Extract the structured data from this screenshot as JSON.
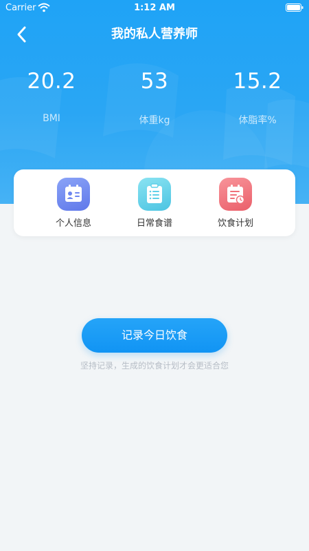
{
  "status_bar": {
    "carrier": "Carrier",
    "time": "1:12 AM"
  },
  "nav": {
    "title": "我的私人营养师"
  },
  "stats": [
    {
      "value": "20.2",
      "label": "BMI"
    },
    {
      "value": "53",
      "label": "体重kg"
    },
    {
      "value": "15.2",
      "label": "体脂率%"
    }
  ],
  "menu": [
    {
      "label": "个人信息",
      "icon": "id-card-icon",
      "color": "#6d86f0"
    },
    {
      "label": "日常食谱",
      "icon": "list-icon",
      "color": "#5fd0e8"
    },
    {
      "label": "饮食计划",
      "icon": "calendar-icon",
      "color": "#f0707a"
    }
  ],
  "action": {
    "button_label": "记录今日饮食",
    "hint": "坚持记录，生成的饮食计划才会更适合您"
  }
}
